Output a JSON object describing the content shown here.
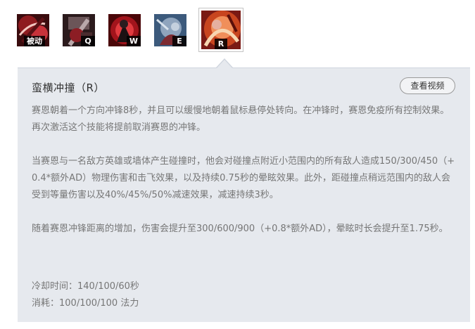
{
  "skills": [
    {
      "key": "被动",
      "icon": "passive-skill-icon"
    },
    {
      "key": "Q",
      "icon": "q-skill-icon"
    },
    {
      "key": "W",
      "icon": "w-skill-icon"
    },
    {
      "key": "E",
      "icon": "e-skill-icon"
    },
    {
      "key": "R",
      "icon": "r-skill-icon",
      "active": true
    }
  ],
  "detail": {
    "title": "蛮横冲撞（R）",
    "video_button": "查看视频",
    "paragraphs": [
      "赛恩朝着一个方向冲锋8秒，并且可以缓慢地朝着鼠标悬停处转向。在冲锋时，赛恩免疫所有控制效果。再次激活这个技能将提前取消赛恩的冲锋。",
      "当赛恩与一名敌方英雄或墙体产生碰撞时，他会对碰撞点附近小范围内的所有敌人造成150/300/450（+0.4*额外AD）物理伤害和击飞效果，以及持续0.75秒的晕眩效果。此外，距碰撞点稍远范围内的敌人会受到等量伤害以及40%/45%/50%减速效果，减速持续3秒。",
      "随着赛恩冲锋距离的增加，伤害会提升至300/600/900（+0.8*额外AD），晕眩时长会提升至1.75秒。"
    ],
    "cooldown": "冷却时间：140/100/60秒",
    "cost": "消耗：100/100/100 法力"
  },
  "colors": {
    "panel_bg": "#e6e9ee",
    "text": "#767676",
    "title": "#333333"
  }
}
